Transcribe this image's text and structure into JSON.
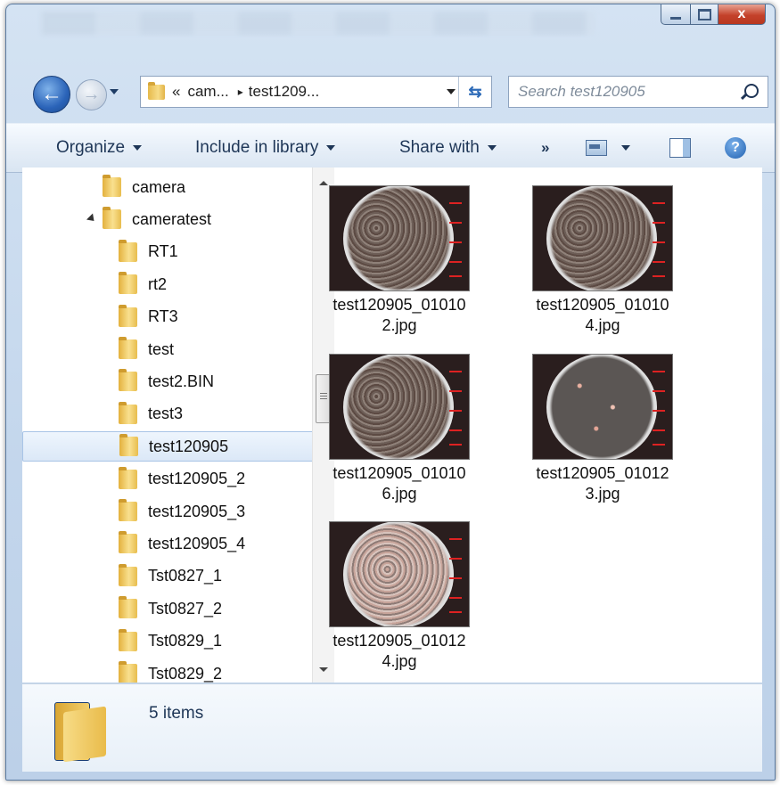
{
  "window": {
    "controls": {
      "minimize": "–",
      "maximize": "□",
      "close": "x"
    }
  },
  "nav": {
    "back_glyph": "←",
    "forward_glyph": "→"
  },
  "address": {
    "overflow": "«",
    "segments": [
      "cam...",
      "test1209..."
    ],
    "separator": "▸",
    "refresh_glyph": "⇆"
  },
  "search": {
    "placeholder": "Search test120905"
  },
  "toolbar": {
    "organize": "Organize",
    "include_in_library": "Include in library",
    "share_with": "Share with",
    "more": "»",
    "help": "?"
  },
  "tree": [
    {
      "label": "camera",
      "level": 1,
      "selected": false,
      "expanded": false
    },
    {
      "label": "cameratest",
      "level": 1,
      "selected": false,
      "expanded": true
    },
    {
      "label": "RT1",
      "level": 2,
      "selected": false
    },
    {
      "label": "rt2",
      "level": 2,
      "selected": false
    },
    {
      "label": "RT3",
      "level": 2,
      "selected": false
    },
    {
      "label": "test",
      "level": 2,
      "selected": false
    },
    {
      "label": "test2.BIN",
      "level": 2,
      "selected": false
    },
    {
      "label": "test3",
      "level": 2,
      "selected": false
    },
    {
      "label": "test120905",
      "level": 2,
      "selected": true
    },
    {
      "label": "test120905_2",
      "level": 2,
      "selected": false
    },
    {
      "label": "test120905_3",
      "level": 2,
      "selected": false
    },
    {
      "label": "test120905_4",
      "level": 2,
      "selected": false
    },
    {
      "label": "Tst0827_1",
      "level": 2,
      "selected": false
    },
    {
      "label": "Tst0827_2",
      "level": 2,
      "selected": false
    },
    {
      "label": "Tst0829_1",
      "level": 2,
      "selected": false
    },
    {
      "label": "Tst0829_2",
      "level": 2,
      "selected": false
    }
  ],
  "files": [
    {
      "line1": "test120905_01010",
      "line2": "2.jpg",
      "variant": "medium"
    },
    {
      "line1": "test120905_01010",
      "line2": "4.jpg",
      "variant": "medium"
    },
    {
      "line1": "test120905_01010",
      "line2": "6.jpg",
      "variant": "dense"
    },
    {
      "line1": "test120905_01012",
      "line2": "3.jpg",
      "variant": "sparse"
    },
    {
      "line1": "test120905_01012",
      "line2": "4.jpg",
      "variant": "mixed"
    }
  ],
  "details": {
    "item_count": "5 items"
  },
  "colors": {
    "accent": "#2a63b8",
    "selection": "#dbe8f7",
    "folder": "#e8bd4e"
  }
}
